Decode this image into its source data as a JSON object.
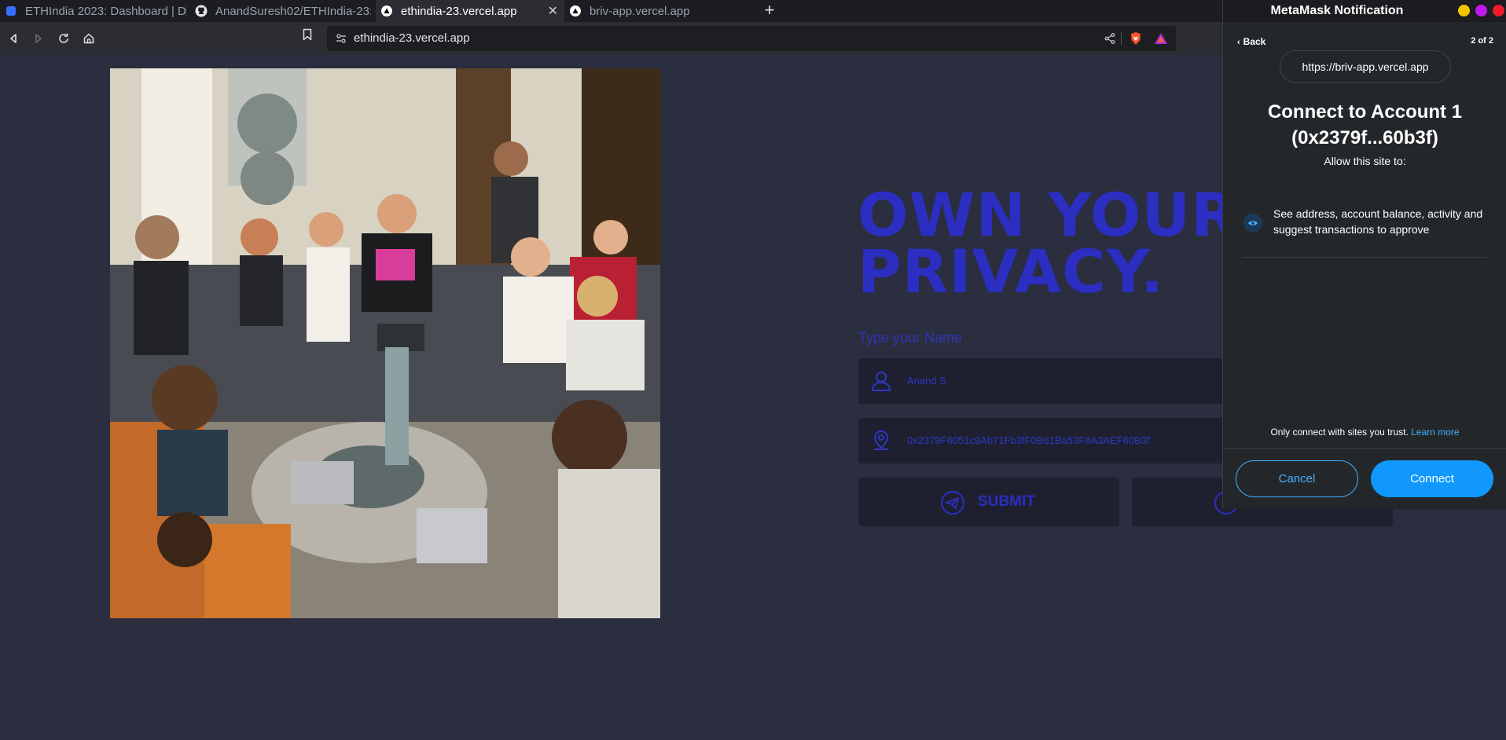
{
  "browser": {
    "tabs": [
      {
        "title": "ETHIndia 2023: Dashboard | D",
        "icon": "devfolio-icon",
        "active": false
      },
      {
        "title": "AnandSuresh02/ETHIndia-23:",
        "icon": "github-icon",
        "active": false
      },
      {
        "title": "ethindia-23.vercel.app",
        "icon": "vercel-icon",
        "active": true
      },
      {
        "title": "briv-app.vercel.app",
        "icon": "vercel-icon",
        "active": false
      }
    ],
    "address": "ethindia-23.vercel.app",
    "colors": {
      "tabbar": "#1c1d22",
      "toolbar": "#2b2d33"
    }
  },
  "page": {
    "headline_line1": "OWN YOUR",
    "headline_line2": "PRIVACY.",
    "name_label": "Type your Name",
    "name_value": "Anand S",
    "address_value": "0x2379F6051c9Ab71Fb3fF0B61Ba53F8A3AEF60B3f",
    "submit_label": "SUBMIT",
    "accent_color": "#2b2ec0",
    "background_color": "#2a2e3f"
  },
  "metamask": {
    "window_title": "MetaMask Notification",
    "back_label": "Back",
    "step": "2 of 2",
    "origin": "https://briv-app.vercel.app",
    "heading_line1": "Connect to Account 1",
    "heading_line2": "(0x2379f...60b3f)",
    "subheading": "Allow this site to:",
    "permission": "See address, account balance, activity and suggest transactions to approve",
    "trust_text": "Only connect with sites you trust.",
    "learn_more": "Learn more",
    "cancel_label": "Cancel",
    "connect_label": "Connect",
    "colors": {
      "primary": "#1098fc",
      "background": "#24272a"
    }
  }
}
